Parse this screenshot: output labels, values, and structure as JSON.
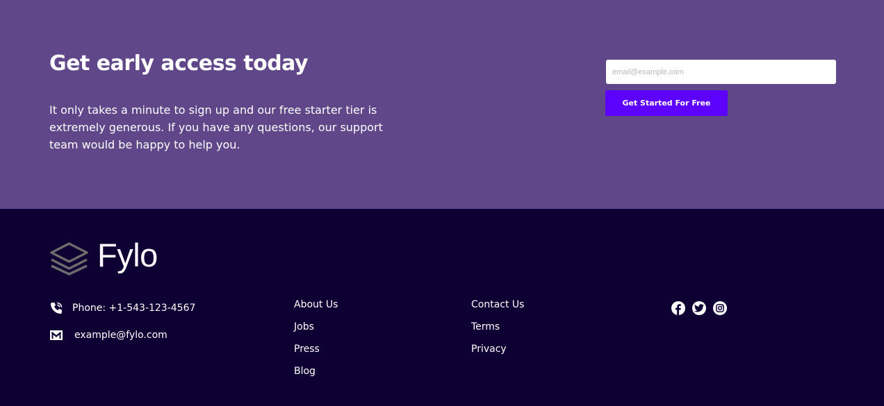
{
  "cta": {
    "title": "Get early access today",
    "description": "It only takes a minute to sign up and our free starter tier is extremely generous. If you have any questions, our support team would be happy to help you.",
    "email_placeholder": "email@example.com",
    "button_label": "Get Started For Free"
  },
  "footer": {
    "logo_text": "Fylo",
    "logo_icon": "layers-icon",
    "contact": {
      "phone": "Phone: +1-543-123-4567",
      "phone_icon": "phone-icon",
      "email": "example@fylo.com",
      "email_icon": "mail-icon"
    },
    "links_col1": [
      "About Us",
      "Jobs",
      "Press",
      "Blog"
    ],
    "links_col2": [
      "Contact Us",
      "Terms",
      "Privacy"
    ],
    "social": [
      "facebook-icon",
      "twitter-icon",
      "instagram-icon"
    ]
  },
  "colors": {
    "cta_background": "#5f478a",
    "footer_background": "#0f0034",
    "button": "#5d02fd",
    "text": "#ffffff"
  }
}
